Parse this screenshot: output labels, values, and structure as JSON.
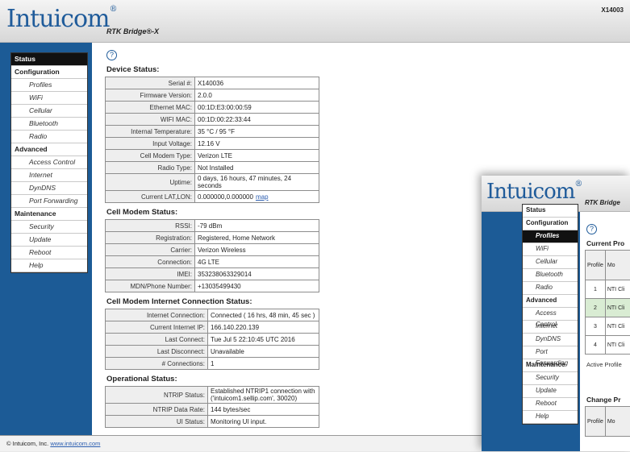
{
  "brand": "Intuicom",
  "product": "RTK Bridge®-X",
  "header_serial": "X14003",
  "nav": [
    {
      "label": "Status",
      "type": "sec",
      "active": true
    },
    {
      "label": "Configuration",
      "type": "sec"
    },
    {
      "label": "Profiles",
      "type": "item"
    },
    {
      "label": "WiFi",
      "type": "item"
    },
    {
      "label": "Cellular",
      "type": "item"
    },
    {
      "label": "Bluetooth",
      "type": "item"
    },
    {
      "label": "Radio",
      "type": "item"
    },
    {
      "label": "Advanced",
      "type": "sec"
    },
    {
      "label": "Access Control",
      "type": "item"
    },
    {
      "label": "Internet",
      "type": "item"
    },
    {
      "label": "DynDNS",
      "type": "item"
    },
    {
      "label": "Port Forwarding",
      "type": "item"
    },
    {
      "label": "Maintenance",
      "type": "sec"
    },
    {
      "label": "Security",
      "type": "item"
    },
    {
      "label": "Update",
      "type": "item"
    },
    {
      "label": "Reboot",
      "type": "item"
    },
    {
      "label": "Help",
      "type": "item"
    }
  ],
  "help_icon": "?",
  "sections": [
    {
      "title": "Device Status:",
      "key_width": 104,
      "rows": [
        [
          "Serial #:",
          "X140036"
        ],
        [
          "Firmware Version:",
          "2.0.0"
        ],
        [
          "Ethernet MAC:",
          "00:1D:E3:00:00:59"
        ],
        [
          "WIFI MAC:",
          "00:1D:00:22:33:44"
        ],
        [
          "Internal Temperature:",
          "35 °C / 95 °F"
        ],
        [
          "Input Voltage:",
          "12.16 V"
        ],
        [
          "Cell Modem Type:",
          "Verizon LTE"
        ],
        [
          "Radio Type:",
          "Not Installed"
        ],
        [
          "Uptime:",
          "0 days, 16 hours, 47 minutes, 24 seconds"
        ],
        [
          "Current LAT,LON:",
          "0.000000,0.000000",
          "map"
        ]
      ]
    },
    {
      "title": "Cell Modem Status:",
      "key_width": 104,
      "rows": [
        [
          "RSSI:",
          "-79 dBm"
        ],
        [
          "Registration:",
          "Registered, Home Network"
        ],
        [
          "Carrier:",
          "Verizon Wireless"
        ],
        [
          "Connection:",
          "4G LTE"
        ],
        [
          "IMEI:",
          "353238063329014"
        ],
        [
          "MDN/Phone Number:",
          "+13035499430"
        ]
      ]
    },
    {
      "title": "Cell Modem Internet Connection Status:",
      "key_width": 120,
      "rows": [
        [
          "Internet Connection:",
          "Connected ( 16 hrs, 48 min, 45 sec )"
        ],
        [
          "Current Internet IP:",
          "166.140.220.139"
        ],
        [
          "Last Connect:",
          "Tue Jul 5 22:10:45 UTC 2016"
        ],
        [
          "Last Disconnect:",
          "Unavailable"
        ],
        [
          "# Connections:",
          "1"
        ]
      ]
    },
    {
      "title": "Operational Status:",
      "key_width": 120,
      "rows": [
        [
          "NTRIP Status:",
          "Established NTRIP1 connection with ('intuicom1.sellip.com', 30020)"
        ],
        [
          "NTRIP Data Rate:",
          "144 bytes/sec"
        ],
        [
          "UI Status:",
          "Monitoring UI input."
        ]
      ]
    }
  ],
  "footer": {
    "text": "© Intuicom, Inc.",
    "link": "www.intuicom.com"
  },
  "win2": {
    "product": "RTK Bridge",
    "nav_active": "Profiles",
    "current_title": "Current Pro",
    "col_profile": "Profile",
    "col_mode": "Mo",
    "rows": [
      {
        "num": "1",
        "mode": "NTI Cli"
      },
      {
        "num": "2",
        "mode": "NTI Cli",
        "selected": true
      },
      {
        "num": "3",
        "mode": "NTI Cli"
      },
      {
        "num": "4",
        "mode": "NTI Cli"
      }
    ],
    "active_profile": "Active Profile",
    "change_title": "Change Pr",
    "col2_profile": "Profile",
    "col2_mode": "Mo"
  }
}
